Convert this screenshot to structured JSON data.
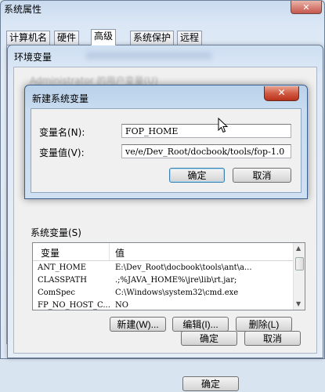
{
  "outer_window": {
    "title": "系统属性",
    "close_label": "✕",
    "tabs": [
      "计算机名",
      "硬件",
      "高级",
      "系统保护",
      "远程"
    ],
    "active_tab": "高级"
  },
  "env_window": {
    "title": "环境变量",
    "user_vars_label": "Administrator 的用户变量(U)",
    "system_vars_label": "系统变量(S)",
    "columns": [
      "变量",
      "值"
    ],
    "rows": [
      {
        "name": "ANT_HOME",
        "value": "E:\\Dev_Root\\docbook\\tools\\ant\\a..."
      },
      {
        "name": "CLASSPATH",
        "value": ".;%JAVA_HOME%\\jre\\lib\\rt.jar;"
      },
      {
        "name": "ComSpec",
        "value": "C:\\Windows\\system32\\cmd.exe"
      },
      {
        "name": "FP_NO_HOST_C...",
        "value": "NO"
      }
    ],
    "new_button": "新建(W)...",
    "edit_button": "编辑(I)...",
    "delete_button": "删除(L)",
    "ok_button": "确定",
    "cancel_button": "取消"
  },
  "new_var_dialog": {
    "title": "新建系统变量",
    "close_label": "✕",
    "name_label": "变量名(N):",
    "value_label": "变量值(V):",
    "name_value": "FOP_HOME",
    "value_value": "ve/e/Dev_Root/docbook/tools/fop-1.0",
    "ok_button": "确定",
    "cancel_button": "取消"
  }
}
